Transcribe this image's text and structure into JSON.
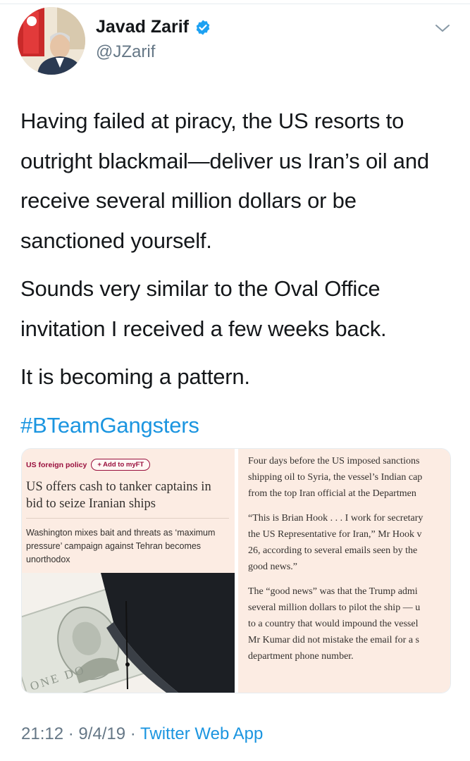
{
  "author": {
    "name": "Javad Zarif",
    "handle": "@JZarif",
    "verified_icon": "verified-badge-icon",
    "menu_icon": "chevron-down-icon"
  },
  "tweet": {
    "paragraphs": [
      "Having failed at piracy, the US resorts to outright blackmail—deliver us Iran’s oil and receive several million dollars or be sanctioned yourself.",
      "Sounds very similar to the Oval Office invitation I received a few weeks back.",
      "It is becoming a pattern."
    ],
    "hashtag": "#BTeamGangsters"
  },
  "attachment": {
    "left": {
      "section": "US foreign policy",
      "add_button": "+ Add to myFT",
      "headline": "US offers cash to tanker captains in bid to seize Iranian ships",
      "standfirst": "Washington mixes bait and threats as ‘maximum pressure’ campaign against Tehran becomes unorthodox",
      "image_text": "ONE DO"
    },
    "right": {
      "paragraphs": [
        [
          "Four days before the US imposed sanctions",
          "shipping oil to Syria, the vessel’s Indian cap",
          "from the top Iran official at the Departmen"
        ],
        [
          "“This is Brian Hook . . . I work for secretary",
          "the US Representative for Iran,” Mr Hook v",
          "26, according to several emails seen by the",
          "good news.”"
        ],
        [
          "The “good news” was that the Trump admi",
          "several million dollars to pilot the ship — u",
          "to a country that would impound the vessel",
          "Mr Kumar did not mistake the email for a s",
          "department phone number."
        ]
      ]
    }
  },
  "meta": {
    "time": "21:12",
    "date": "9/4/19",
    "separator": " · ",
    "app": "Twitter Web App"
  },
  "colors": {
    "link": "#1b95e0",
    "secondary": "#657786",
    "ft_background": "#fcece3",
    "ft_claret": "#990f3d"
  }
}
